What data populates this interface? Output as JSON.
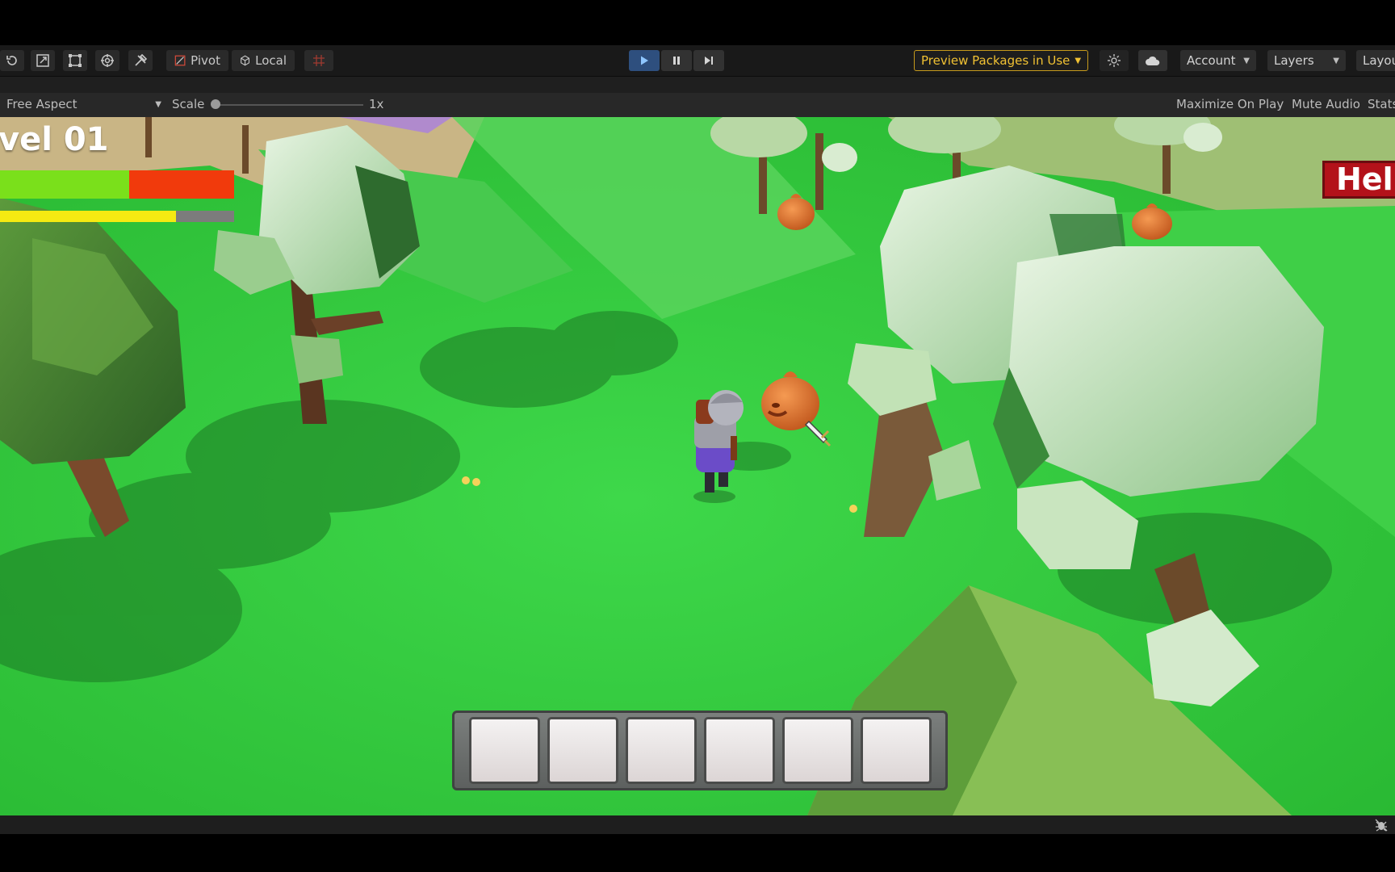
{
  "toolbar": {
    "tools": [
      {
        "icon": "rotate-tool-icon"
      },
      {
        "icon": "scale-tool-icon"
      },
      {
        "icon": "rect-tool-icon"
      },
      {
        "icon": "transform-tool-icon"
      },
      {
        "icon": "custom-tools-icon"
      }
    ],
    "pivot_label": "Pivot",
    "local_label": "Local",
    "grid_snap_icon": "grid-snap-icon",
    "play_icon": "play-icon",
    "pause_icon": "pause-icon",
    "step_icon": "step-icon",
    "preview_packages_label": "Preview Packages in Use",
    "account_label": "Account",
    "layers_label": "Layers",
    "layout_label": "Layou",
    "accent": "#f0c133",
    "play_active_color": "#2e4f7e"
  },
  "gameview": {
    "aspect_label": "Free Aspect",
    "scale_label": "Scale",
    "scale_value": "1x",
    "maximize_label": "Maximize On Play",
    "mute_label": "Mute Audio",
    "stats_label": "Stats"
  },
  "hud": {
    "level_text": "vel 01",
    "health_fraction": 0.55,
    "health_color": "#7ae01b",
    "health_missing_color": "#f13a0c",
    "xp_fraction": 0.75,
    "xp_color": "#f5ea12",
    "help_text": "Hel",
    "hotbar_slot_count": 6
  }
}
